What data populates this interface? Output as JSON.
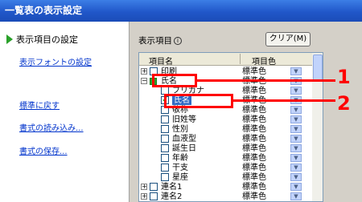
{
  "window": {
    "title": "一覧表の表示設定"
  },
  "left_nav": {
    "active_item": "表示項目の設定",
    "links": [
      "表示フォントの設定",
      "標準に戻す",
      "書式の読み込み...",
      "書式の保存..."
    ]
  },
  "panel": {
    "label": "表示項目",
    "info_glyph": "i",
    "clear_button": "クリア(M)"
  },
  "table": {
    "headers": {
      "name": "項目名",
      "color": "項目色"
    },
    "rows": [
      {
        "name": "印刷",
        "color": "標準色"
      },
      {
        "name": "氏名",
        "color": "標準色"
      },
      {
        "name": "フリガナ",
        "color": "標準色"
      },
      {
        "name": "氏名",
        "color": "標準色"
      },
      {
        "name": "敬称",
        "color": "標準色"
      },
      {
        "name": "旧姓等",
        "color": "標準色"
      },
      {
        "name": "性別",
        "color": "標準色"
      },
      {
        "name": "血液型",
        "color": "標準色"
      },
      {
        "name": "誕生日",
        "color": "標準色"
      },
      {
        "name": "年齢",
        "color": "標準色"
      },
      {
        "name": "干支",
        "color": "標準色"
      },
      {
        "name": "星座",
        "color": "標準色"
      },
      {
        "name": "連名1",
        "color": "標準色"
      },
      {
        "name": "連名2",
        "color": "標準色"
      }
    ]
  },
  "callouts": [
    "1",
    "2"
  ],
  "colors": {
    "accent": "#316ac5",
    "callout": "#ff0000",
    "check": "#2aa12a"
  },
  "icons": [
    "play-icon",
    "info-icon",
    "expand-icon",
    "collapse-icon",
    "checkbox-icon",
    "dropdown-icon"
  ]
}
